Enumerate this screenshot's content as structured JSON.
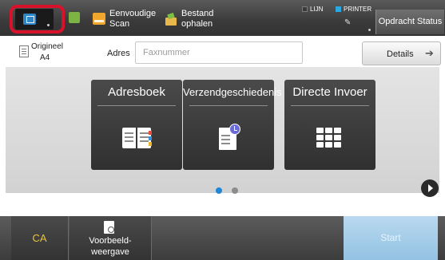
{
  "topbar": {
    "easy_scan": [
      "Eenvoudige",
      "Scan"
    ],
    "file_retrieve": [
      "Bestand",
      "ophalen"
    ],
    "indicators": [
      {
        "label": "LIJN",
        "color": "#3a3a3a"
      },
      {
        "label": "PRINTER",
        "color": "#29a9e0"
      }
    ],
    "job_status": "Opdracht Status"
  },
  "original": {
    "label": "Origineel",
    "size": "A4"
  },
  "address": {
    "label": "Adres",
    "placeholder": "Faxnummer"
  },
  "details": {
    "label": "Details"
  },
  "tiles": [
    "Adresboek",
    "Verzendgeschiedenis",
    "Directe Invoer"
  ],
  "colors": {
    "highlight": "#d9122b",
    "accent_blue": "#2f86c6",
    "ca_text": "#e8c340",
    "start_bg": "#a9d0ea",
    "page_dot_active": "#1e88d6",
    "page_dot_inactive": "#8c8c8c"
  },
  "pagination": {
    "current": 1,
    "total": 2
  },
  "bottom": {
    "ca": "CA",
    "preview": [
      "Voorbeeld-",
      "weergave"
    ],
    "start": "Start"
  }
}
